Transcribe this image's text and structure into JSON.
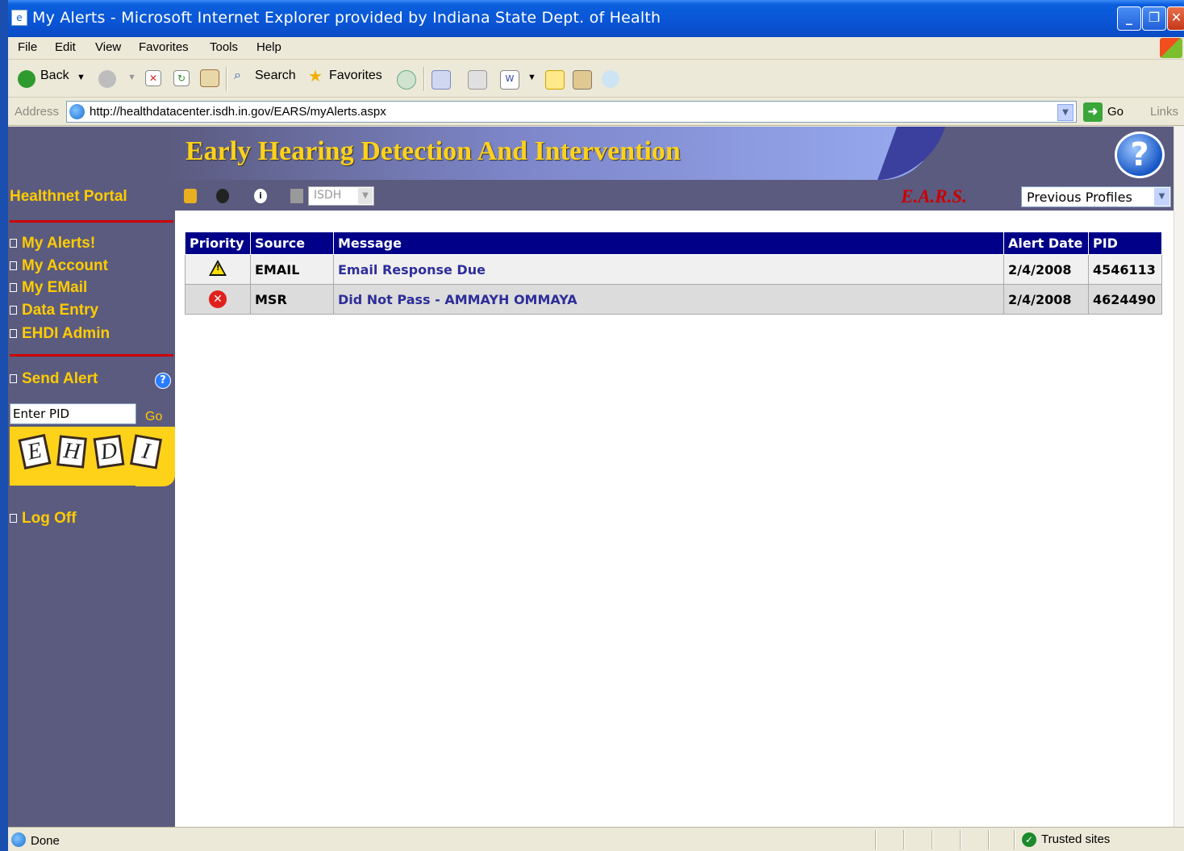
{
  "window": {
    "title": "My Alerts - Microsoft Internet Explorer provided by Indiana State Dept. of Health"
  },
  "menu": [
    "File",
    "Edit",
    "View",
    "Favorites",
    "Tools",
    "Help"
  ],
  "toolbar": {
    "back_label": "Back",
    "search_label": "Search",
    "favorites_label": "Favorites"
  },
  "address": {
    "label": "Address",
    "url": "http://healthdatacenter.isdh.in.gov/EARS/myAlerts.aspx",
    "go_label": "Go",
    "links_label": "Links"
  },
  "page": {
    "banner_title": "Early Hearing Detection And Intervention",
    "portal_label": "Healthnet Portal",
    "agency_select": "ISDH",
    "ears_label": "E.A.R.S.",
    "profiles_select": "Previous Profiles"
  },
  "sidebar": {
    "items": [
      {
        "label": "My Alerts!"
      },
      {
        "label": "My Account"
      },
      {
        "label": "My EMail"
      },
      {
        "label": "Data Entry"
      },
      {
        "label": "EHDI Admin"
      }
    ],
    "send_alert": "Send Alert",
    "pid_value": "Enter PID",
    "pid_go": "Go",
    "logo_letters": [
      "E",
      "H",
      "D",
      "I"
    ],
    "log_off": "Log Off"
  },
  "alerts": {
    "columns": [
      "Priority",
      "Source",
      "Message",
      "Alert Date",
      "PID"
    ],
    "rows": [
      {
        "priority": "warning-icon",
        "source": "EMAIL",
        "message": "Email Response Due",
        "date": "2/4/2008",
        "pid": "4546113"
      },
      {
        "priority": "error-icon",
        "source": "MSR",
        "message": "Did Not Pass - AMMAYH OMMAYA",
        "date": "2/4/2008",
        "pid": "4624490"
      }
    ]
  },
  "status": {
    "text": "Done",
    "zone": "Trusted sites"
  },
  "colors": {
    "banner_bg": "#5b5b80",
    "banner_title": "#ffd21a",
    "nav_text": "#ffcc00",
    "table_header": "#000088",
    "ears_red": "#cc0000"
  }
}
